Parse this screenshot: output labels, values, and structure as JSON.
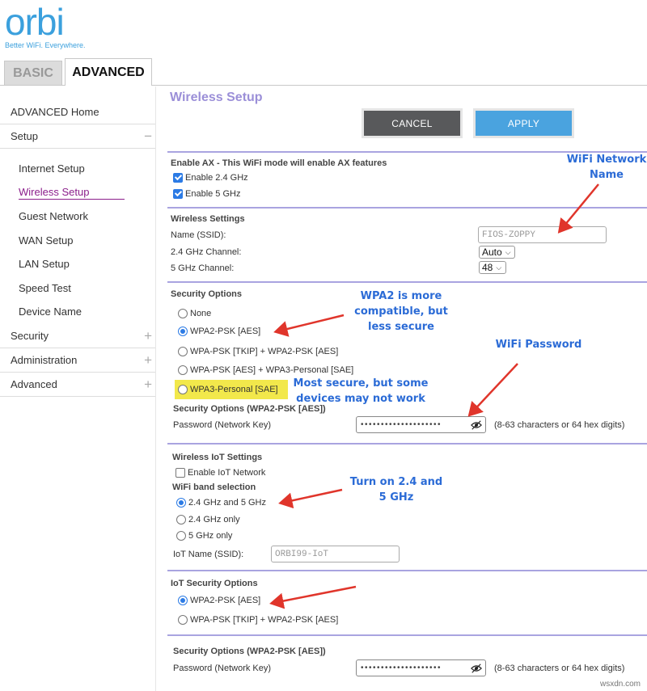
{
  "logo": {
    "word": "orbi",
    "tagline": "Better WiFi. Everywhere."
  },
  "tabs": {
    "basic": "BASIC",
    "advanced": "ADVANCED"
  },
  "sidebar": {
    "advanced_home": "ADVANCED Home",
    "setup": "Setup",
    "setup_items": [
      "Internet Setup",
      "Wireless Setup",
      "Guest Network",
      "WAN Setup",
      "LAN Setup",
      "Speed Test",
      "Device Name"
    ],
    "active_item": "Wireless Setup",
    "security": "Security",
    "administration": "Administration",
    "advanced": "Advanced",
    "collapse_sign": "−",
    "expand_sign": "+"
  },
  "page": {
    "title": "Wireless Setup"
  },
  "buttons": {
    "cancel": "CANCEL",
    "apply": "APPLY"
  },
  "ax": {
    "heading": "Enable AX - This WiFi mode will enable AX features",
    "enable_24": "Enable 2.4 GHz",
    "enable_5": "Enable 5 GHz",
    "enable_24_checked": true,
    "enable_5_checked": true
  },
  "wireless_settings": {
    "heading": "Wireless Settings",
    "ssid_label": "Name (SSID):",
    "ssid_value": "FIOS-ZOPPY",
    "ch24_label": "2.4 GHz Channel:",
    "ch24_value": "Auto",
    "ch5_label": "5 GHz Channel:",
    "ch5_value": "48"
  },
  "security_options": {
    "heading": "Security Options",
    "options": [
      "None",
      "WPA2-PSK [AES]",
      "WPA-PSK [TKIP] + WPA2-PSK [AES]",
      "WPA-PSK [AES] + WPA3-Personal [SAE]",
      "WPA3-Personal [SAE]"
    ],
    "selected": "WPA2-PSK [AES]",
    "sub_heading": "Security Options (WPA2-PSK [AES])",
    "password_label": "Password (Network Key)",
    "password_mask": "••••••••••••••••••••",
    "password_hint": "(8-63 characters or 64 hex digits)"
  },
  "iot_settings": {
    "heading": "Wireless IoT Settings",
    "enable_label": "Enable IoT Network",
    "enable_checked": false,
    "band_heading": "WiFi band selection",
    "bands": [
      "2.4 GHz and 5 GHz",
      "2.4 GHz only",
      "5 GHz only"
    ],
    "band_selected": "2.4 GHz and 5 GHz",
    "iot_name_label": "IoT Name (SSID):",
    "iot_name_value": "ORBI99-IoT"
  },
  "iot_security": {
    "heading": "IoT Security Options",
    "options": [
      "WPA2-PSK [AES]",
      "WPA-PSK [TKIP] + WPA2-PSK [AES]"
    ],
    "selected": "WPA2-PSK [AES]",
    "sub_heading": "Security Options (WPA2-PSK [AES])",
    "password_label": "Password (Network Key)",
    "password_mask": "••••••••••••••••••••",
    "password_hint": "(8-63 characters or 64 hex digits)"
  },
  "annotations": {
    "wifi_name": [
      "WiFi Network",
      "Name"
    ],
    "wpa2": [
      "WPA2 is more",
      "compatible, but",
      "less secure"
    ],
    "wifi_password": "WiFi Password",
    "most_secure": [
      "Most secure, but some",
      "devices may not work"
    ],
    "turn_on": [
      "Turn on 2.4 and",
      "5 GHz"
    ]
  },
  "watermark": "wsxdn.com",
  "colors": {
    "brand_blue": "#3ba0dd",
    "title_purple": "#9b8fd8",
    "section_line": "#a9a4e0",
    "active_nav": "#8b1e8b",
    "cancel_bg": "#58595b",
    "apply_bg": "#4aa3df",
    "annotation_blue": "#2b6bd6",
    "arrow_red": "#e0352b",
    "highlight_yellow": "#f2e84b"
  }
}
